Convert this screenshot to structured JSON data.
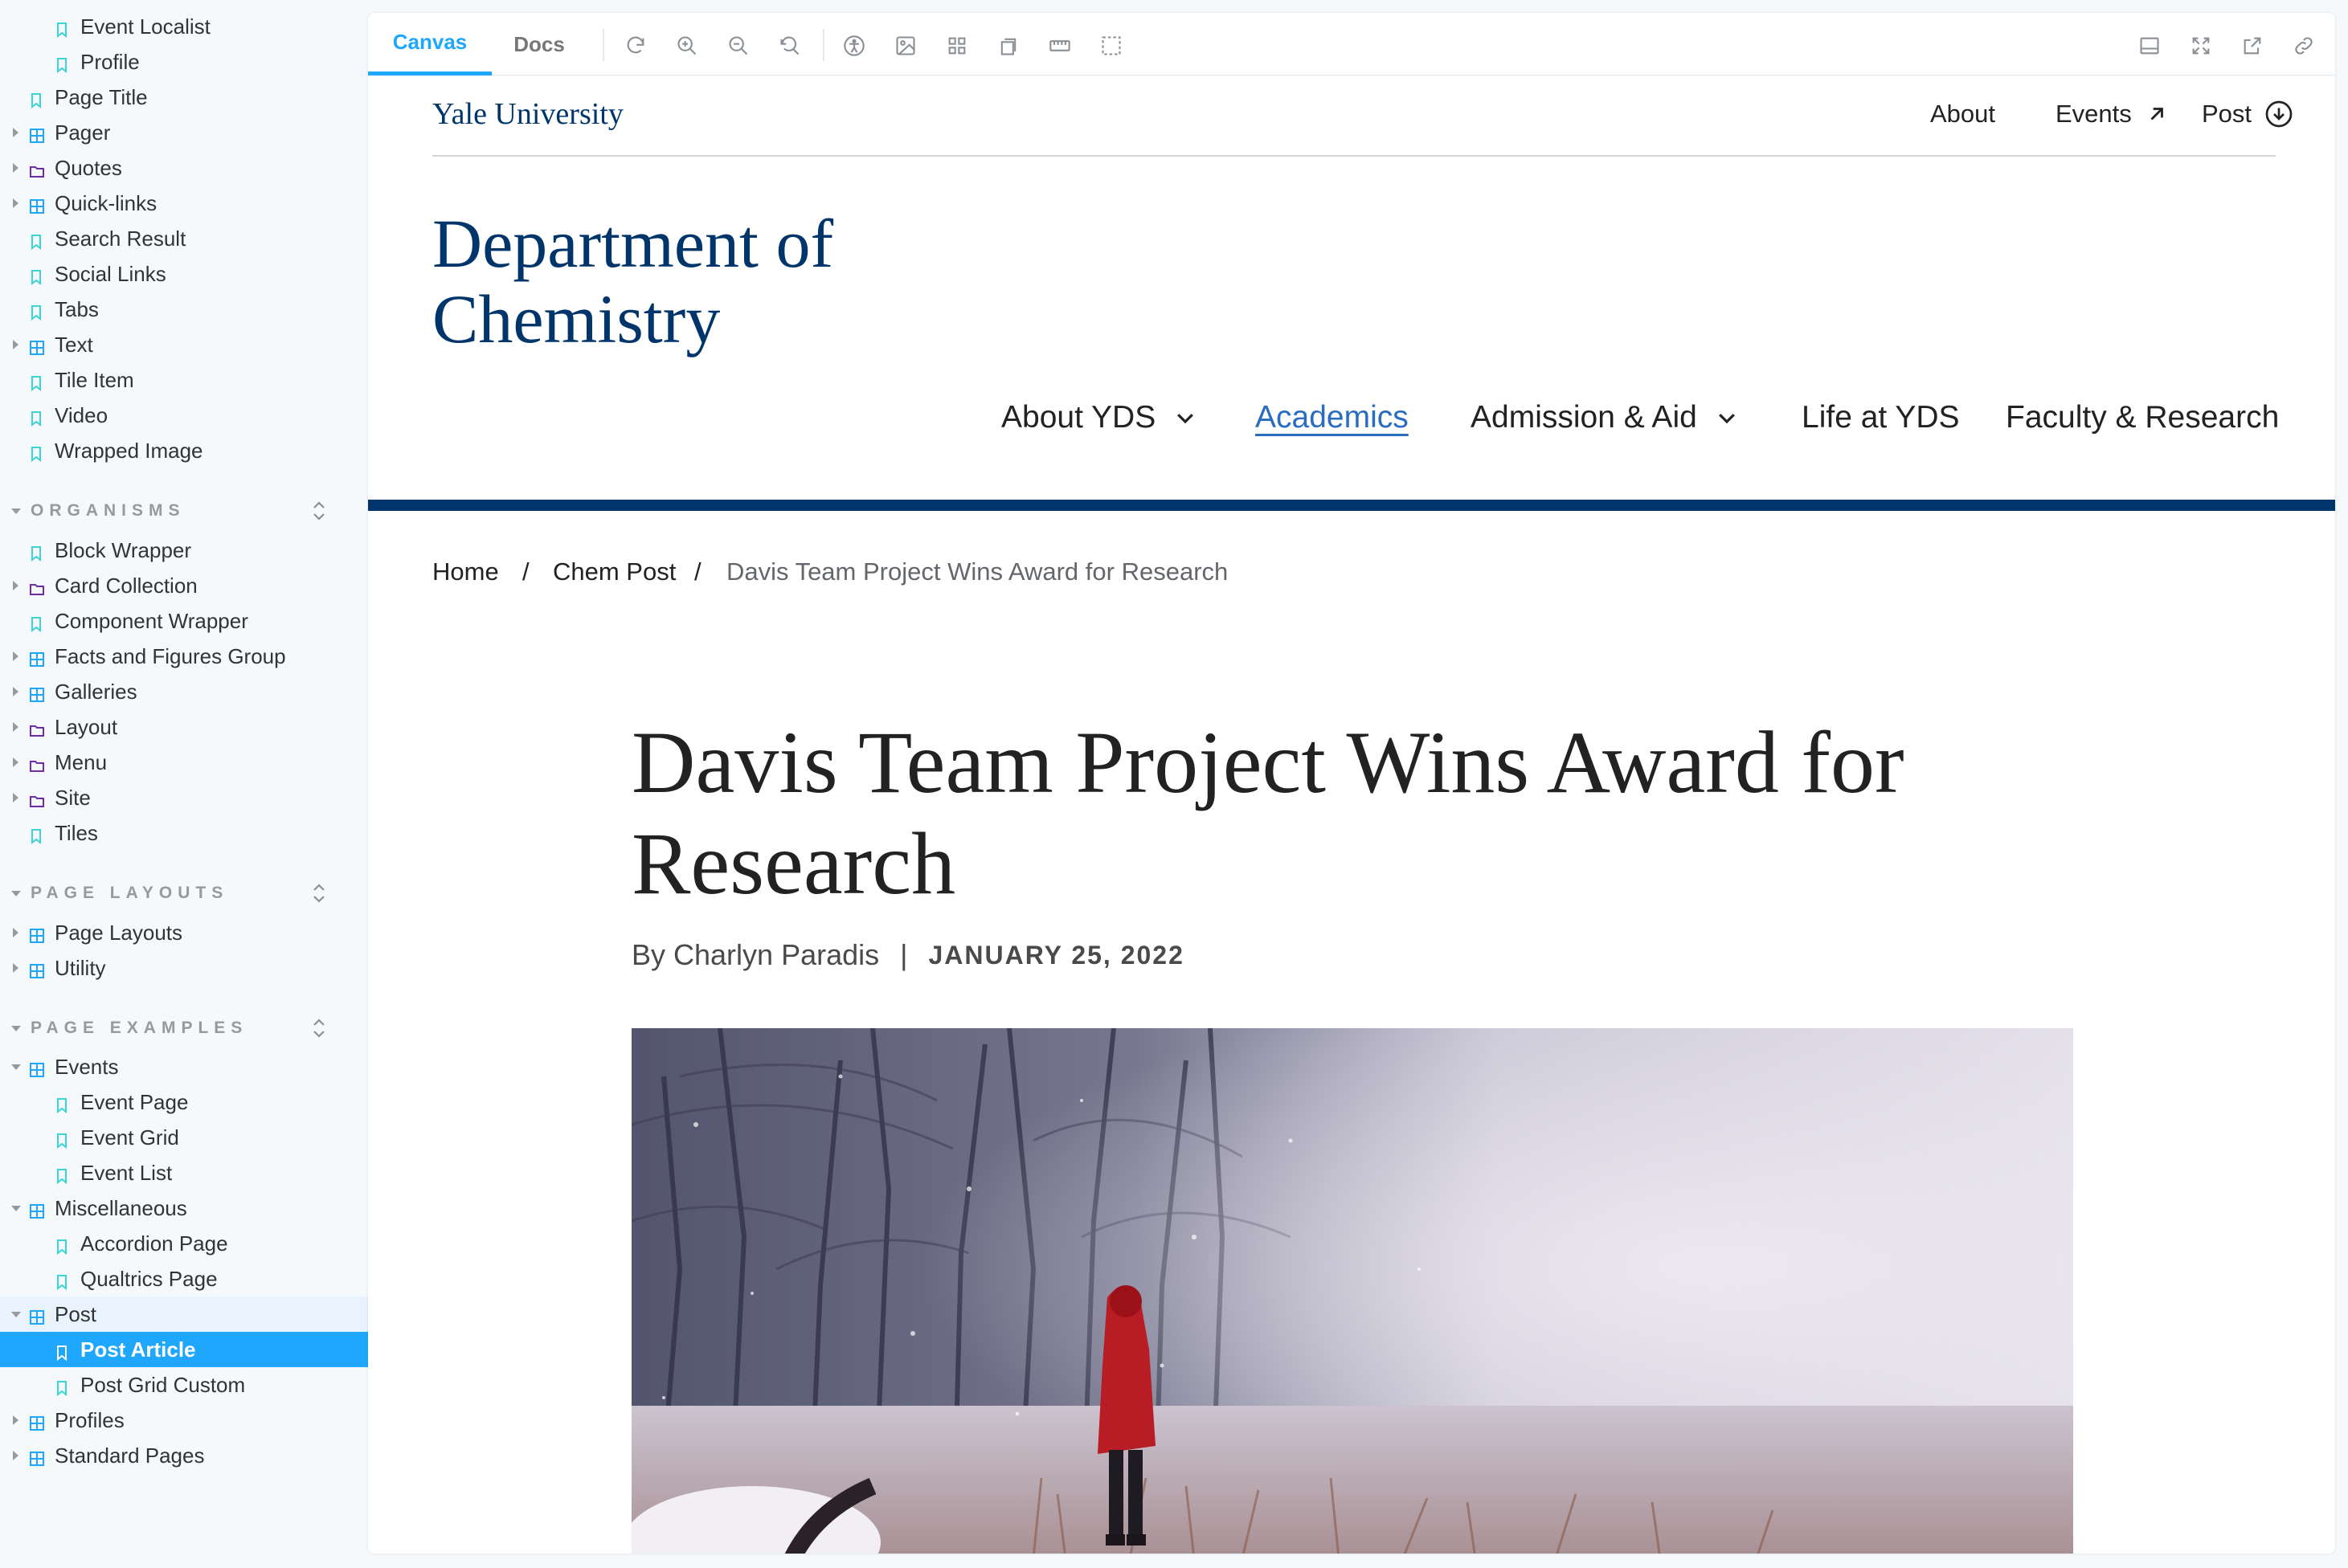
{
  "sidebar": {
    "atoms_tail": [
      {
        "label": "Event Localist",
        "icon": "bookmark-icon",
        "level": 2
      },
      {
        "label": "Profile",
        "icon": "bookmark-icon",
        "level": 2
      },
      {
        "label": "Page Title",
        "icon": "bookmark-icon",
        "level": 1
      },
      {
        "label": "Pager",
        "icon": "component-icon",
        "level": 1,
        "caret": "right"
      },
      {
        "label": "Quotes",
        "icon": "folder-icon",
        "level": 1,
        "caret": "right"
      },
      {
        "label": "Quick-links",
        "icon": "component-icon",
        "level": 1,
        "caret": "right"
      },
      {
        "label": "Search Result",
        "icon": "bookmark-icon",
        "level": 1
      },
      {
        "label": "Social Links",
        "icon": "bookmark-icon",
        "level": 1
      },
      {
        "label": "Tabs",
        "icon": "bookmark-icon",
        "level": 1
      },
      {
        "label": "Text",
        "icon": "component-icon",
        "level": 1,
        "caret": "right"
      },
      {
        "label": "Tile Item",
        "icon": "bookmark-icon",
        "level": 1
      },
      {
        "label": "Video",
        "icon": "bookmark-icon",
        "level": 1
      },
      {
        "label": "Wrapped Image",
        "icon": "bookmark-icon",
        "level": 1
      }
    ],
    "organisms_title": "ORGANISMS",
    "organisms": [
      {
        "label": "Block Wrapper",
        "icon": "bookmark-icon",
        "level": 1
      },
      {
        "label": "Card Collection",
        "icon": "folder-icon",
        "level": 1,
        "caret": "right"
      },
      {
        "label": "Component Wrapper",
        "icon": "bookmark-icon",
        "level": 1
      },
      {
        "label": "Facts and Figures Group",
        "icon": "component-icon",
        "level": 1,
        "caret": "right"
      },
      {
        "label": "Galleries",
        "icon": "component-icon",
        "level": 1,
        "caret": "right"
      },
      {
        "label": "Layout",
        "icon": "folder-icon",
        "level": 1,
        "caret": "right"
      },
      {
        "label": "Menu",
        "icon": "folder-icon",
        "level": 1,
        "caret": "right"
      },
      {
        "label": "Site",
        "icon": "folder-icon",
        "level": 1,
        "caret": "right"
      },
      {
        "label": "Tiles",
        "icon": "bookmark-icon",
        "level": 1
      }
    ],
    "page_layouts_title": "PAGE LAYOUTS",
    "page_layouts": [
      {
        "label": "Page Layouts",
        "icon": "component-icon",
        "level": 1,
        "caret": "right"
      },
      {
        "label": "Utility",
        "icon": "component-icon",
        "level": 1,
        "caret": "right"
      }
    ],
    "page_examples_title": "PAGE EXAMPLES",
    "page_examples": [
      {
        "label": "Events",
        "icon": "component-icon",
        "level": 1,
        "caret": "down"
      },
      {
        "label": "Event Page",
        "icon": "bookmark-icon",
        "level": 2
      },
      {
        "label": "Event Grid",
        "icon": "bookmark-icon",
        "level": 2
      },
      {
        "label": "Event List",
        "icon": "bookmark-icon",
        "level": 2
      },
      {
        "label": "Miscellaneous",
        "icon": "component-icon",
        "level": 1,
        "caret": "down"
      },
      {
        "label": "Accordion Page",
        "icon": "bookmark-icon",
        "level": 2
      },
      {
        "label": "Qualtrics Page",
        "icon": "bookmark-icon",
        "level": 2
      },
      {
        "label": "Post",
        "icon": "component-icon",
        "level": 1,
        "caret": "down",
        "parent_selected": true
      },
      {
        "label": "Post Article",
        "icon": "bookmark-icon",
        "level": 2,
        "selected": true
      },
      {
        "label": "Post Grid Custom",
        "icon": "bookmark-icon",
        "level": 2
      },
      {
        "label": "Profiles",
        "icon": "component-icon",
        "level": 1,
        "caret": "right"
      },
      {
        "label": "Standard Pages",
        "icon": "component-icon",
        "level": 1,
        "caret": "right"
      }
    ]
  },
  "toolbar": {
    "tabs": [
      "Canvas",
      "Docs"
    ],
    "active_tab": "Canvas",
    "tools": [
      "reload-icon",
      "zoom-in-icon",
      "zoom-out-icon",
      "zoom-reset-icon",
      "accessibility-icon",
      "background-icon",
      "grid-icon",
      "viewport-icon",
      "measure-icon",
      "outline-icon"
    ],
    "right_tools": [
      "addons-panel-icon",
      "fullscreen-icon",
      "open-new-tab-icon",
      "copy-link-icon"
    ]
  },
  "site": {
    "logo": "Yale University",
    "utility_nav": [
      "About",
      "Events",
      "Post"
    ],
    "department_line1": "Department of",
    "department_line2": "Chemistry",
    "main_nav": [
      "About YDS",
      "Academics",
      "Admission & Aid",
      "Life at YDS",
      "Faculty & Research"
    ],
    "breadcrumbs": [
      "Home",
      "Chem Post",
      "Davis Team Project Wins Award for Research"
    ],
    "breadcrumb_separator": "/",
    "headline": "Davis Team Project Wins Award for Research",
    "byline": "By Charlyn Paradis",
    "byline_separator": "|",
    "date": "JANUARY 25, 2022",
    "colors": {
      "brand": "#00356b",
      "link": "#286dc0",
      "storybook_accent": "#1ea7fd"
    }
  }
}
